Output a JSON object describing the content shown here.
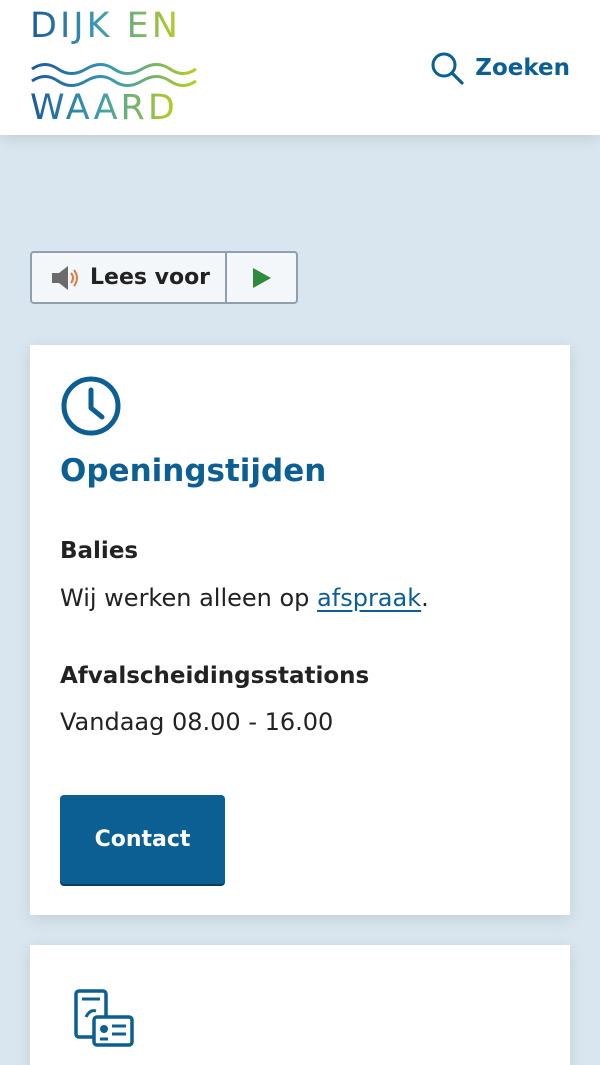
{
  "header": {
    "logo": {
      "line1": "DIJK EN",
      "line2": "WAARD"
    },
    "search": {
      "label": "Zoeken",
      "icon": "search-icon"
    }
  },
  "readspeaker": {
    "label": "Lees voor",
    "icons": {
      "speaker": "speaker-icon",
      "play": "play-icon"
    }
  },
  "hours_card": {
    "icon": "clock-icon",
    "title": "Openingstijden",
    "balies": {
      "heading": "Balies",
      "text_before": "Wij werken alleen op ",
      "link": "afspraak",
      "text_after": "."
    },
    "afval": {
      "heading": "Afvalscheidingsstations",
      "text": "Vandaag 08.00 - 16.00"
    },
    "contact_button": "Contact"
  },
  "next_card": {
    "icon": "id-card-icon"
  },
  "colors": {
    "brand_blue": "#0b5f93",
    "page_bg": "#d9e6ef",
    "logo_gradient_start": "#1a5a9c",
    "logo_gradient_end": "#b9cf1e",
    "speaker_accent": "#e07a3e",
    "play_green": "#2e8b3e"
  }
}
